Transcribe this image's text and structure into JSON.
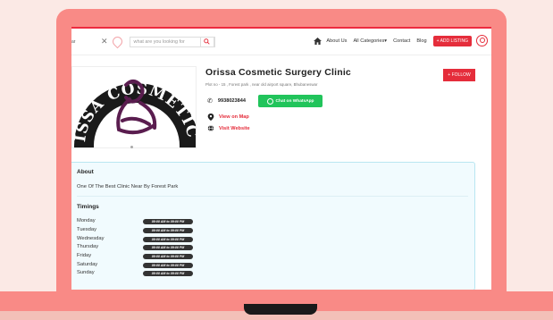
{
  "header": {
    "location_value": "ar",
    "search_placeholder": "what are you looking for",
    "nav": [
      "About Us",
      "All Categories",
      "Contact",
      "Blog"
    ],
    "categories_caret": "▾",
    "add_listing": "+ ADD LISTING"
  },
  "listing": {
    "logo_text": "ISSA COSMETIC SURGERY CLINIC",
    "title": "Orissa Cosmetic Surgery Clinic",
    "address": "Plot no - 15 , Forest park , near old airport square, Bhubaneswar",
    "follow_label": "+ FOLLOW",
    "phone": "9938023844",
    "whatsapp_label": "Chat on WhatsApp",
    "map_label": "View on Map",
    "website_label": "Visit Website"
  },
  "about": {
    "heading": "About",
    "text": "One Of The Best Clinic Near By Forest Park"
  },
  "timings": {
    "heading": "Timings",
    "days": [
      {
        "day": "Monday",
        "hours": "09:00 AM to 09:00 PM"
      },
      {
        "day": "Tuesday",
        "hours": "09:00 AM to 09:00 PM"
      },
      {
        "day": "Wednesday",
        "hours": "09:00 AM to 09:00 PM"
      },
      {
        "day": "Thursday",
        "hours": "09:00 AM to 09:00 PM"
      },
      {
        "day": "Friday",
        "hours": "09:00 AM to 09:00 PM"
      },
      {
        "day": "Saturday",
        "hours": "09:00 AM to 09:00 PM"
      },
      {
        "day": "Sunday",
        "hours": "09:00 AM to 09:00 PM"
      }
    ]
  },
  "colors": {
    "accent": "#e52d3b",
    "laptop": "#f98a86",
    "whatsapp": "#21c45b",
    "card_bg": "#f1fbfe",
    "logo_purple": "#5a1d4f"
  }
}
